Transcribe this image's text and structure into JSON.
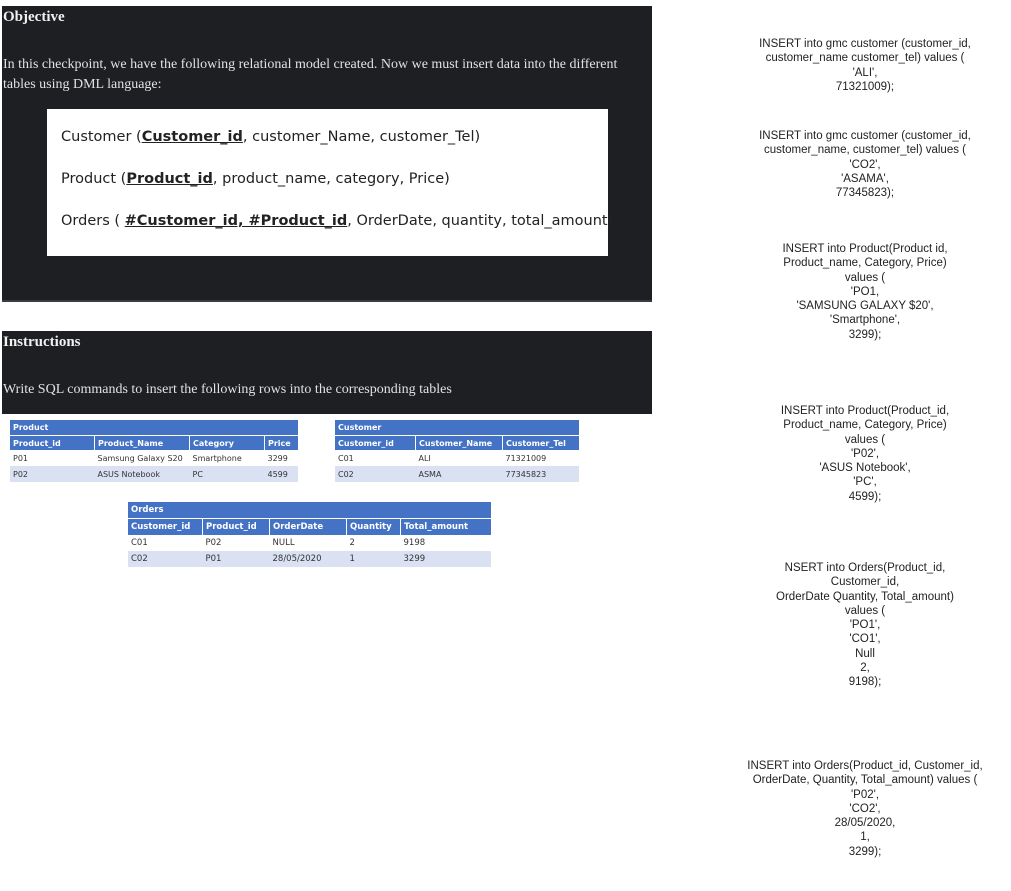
{
  "objective": {
    "heading": "Objective",
    "text": "In this checkpoint, we have the following relational model created. Now we must insert data into the different tables using DML language:",
    "model": {
      "customer": {
        "name": "Customer (",
        "key": "Customer_id",
        "rest": ", customer_Name, customer_Tel)"
      },
      "product": {
        "name": "Product (",
        "key": "Product_id",
        "rest": ", product_name, category, Price)"
      },
      "orders": {
        "name": "Orders ( ",
        "key": "#Customer_id, #Product_id",
        "rest": ", OrderDate, quantity, total_amount)"
      }
    }
  },
  "instructions": {
    "heading": "Instructions",
    "text": "Write SQL commands to insert the following rows into the corresponding tables"
  },
  "tables": {
    "product": {
      "title": "Product",
      "headers": [
        "Product_id",
        "Product_Name",
        "Category",
        "Price"
      ],
      "rows": [
        [
          "P01",
          "Samsung Galaxy S20",
          "Smartphone",
          "3299"
        ],
        [
          "P02",
          "ASUS Notebook",
          "PC",
          "4599"
        ]
      ]
    },
    "customer": {
      "title": "Customer",
      "headers": [
        "Customer_id",
        "Customer_Name",
        "Customer_Tel"
      ],
      "rows": [
        [
          "C01",
          "ALI",
          "71321009"
        ],
        [
          "C02",
          "ASMA",
          "77345823"
        ]
      ]
    },
    "orders": {
      "title": "Orders",
      "headers": [
        "Customer_id",
        "Product_id",
        "OrderDate",
        "Quantity",
        "Total_amount"
      ],
      "rows": [
        [
          "C01",
          "P02",
          "NULL",
          "2",
          "9198"
        ],
        [
          "C02",
          "P01",
          "28/05/2020",
          "1",
          "3299"
        ]
      ]
    }
  },
  "sql_statements": [
    [
      "INSERT into gmc customer (customer_id,",
      "customer_name customer_tel) values (",
      "'ALI',",
      "71321009);"
    ],
    [
      "INSERT into gmc customer (customer_id,",
      "customer_name, customer_tel) values (",
      "'CO2',",
      "'ASAMA',",
      "77345823);"
    ],
    [
      "INSERT into Product(Product id,",
      "Product_name, Category, Price)",
      "values (",
      "'PO1,",
      "'SAMSUNG GALAXY $20',",
      "'Smartphone',",
      "3299);"
    ],
    [
      "INSERT into Product(Product_id,",
      "Product_name, Category, Price)",
      "values (",
      "'P02',",
      "'ASUS Notebook',",
      "'PC',",
      "4599);"
    ],
    [
      "NSERT into Orders(Product_id,",
      "Customer_id,",
      "OrderDate Quantity, Total_amount)",
      "values (",
      "'PO1',",
      "'CO1',",
      "Null",
      "2,",
      "9198);"
    ],
    [
      "INSERT into Orders(Product_id, Customer_id,",
      "OrderDate, Quantity, Total_amount) values (",
      "'P02',",
      "'CO2',",
      "28/05/2020,",
      "1,",
      "3299);"
    ]
  ]
}
